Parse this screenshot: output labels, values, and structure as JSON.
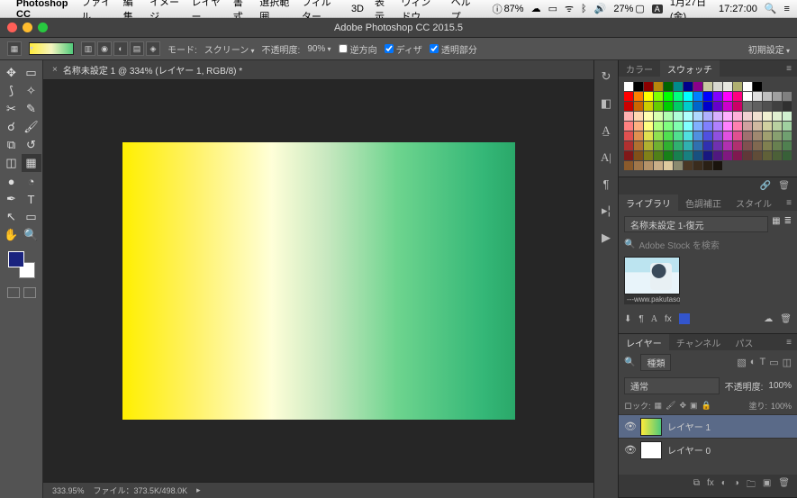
{
  "menubar": {
    "app": "Photoshop CC",
    "items": [
      "ファイル",
      "編集",
      "イメージ",
      "レイヤー",
      "書式",
      "選択範囲",
      "フィルター",
      "3D",
      "表示",
      "ウィンドウ",
      "ヘルプ"
    ],
    "cpu_pct": "87%",
    "battery": "27%",
    "lang": "A",
    "date": "1月27日(金)",
    "time": "17:27:00"
  },
  "window": {
    "title": "Adobe Photoshop CC 2015.5"
  },
  "optionsbar": {
    "mode_label": "モード:",
    "mode_value": "スクリーン",
    "opacity_label": "不透明度:",
    "opacity_value": "90%",
    "reverse": "逆方向",
    "dither": "ディザ",
    "transparency": "透明部分",
    "reset": "初期設定"
  },
  "document": {
    "tab": "名称未設定 1 @ 334% (レイヤー 1, RGB/8) *",
    "zoom": "333.95%",
    "filesize": "ファイル：373.5K/498.0K"
  },
  "panels": {
    "color_tab": "カラー",
    "swatch_tab": "スウォッチ",
    "library_tab": "ライブラリ",
    "cc_tab": "色調補正",
    "style_tab": "スタイル",
    "library_select": "名称未設定 1-復元",
    "search_placeholder": "Adobe Stock を検索",
    "thumb_caption": "---www.pakutaso....",
    "layers_tab": "レイヤー",
    "channels_tab": "チャンネル",
    "paths_tab": "パス",
    "kind_label": "種類",
    "blend_mode": "通常",
    "layer_opacity_label": "不透明度:",
    "layer_opacity_value": "100%",
    "lock_label": "ロック:",
    "fill_label": "塗り:",
    "fill_value": "100%",
    "layers": [
      {
        "name": "レイヤー 1",
        "visible": true,
        "selected": true,
        "thumb": "grad"
      },
      {
        "name": "レイヤー 0",
        "visible": true,
        "selected": false,
        "thumb": "white"
      }
    ]
  },
  "swatches": {
    "row0": [
      "#ffffff",
      "#000000",
      "#8b0000",
      "#b8860b",
      "#006400",
      "#008b8b",
      "#00008b",
      "#8b008b",
      "#c8c8a0",
      "#d8d8d0",
      "#e8e8e0",
      "#b0b070",
      "#ffffff",
      "#000000"
    ],
    "rows": [
      [
        "#ff0000",
        "#ff8000",
        "#ffff00",
        "#80ff00",
        "#00ff00",
        "#00ff80",
        "#00ffff",
        "#0080ff",
        "#0000ff",
        "#8000ff",
        "#ff00ff",
        "#ff0080",
        "#ffffff",
        "#e0e0e0",
        "#c0c0c0",
        "#a0a0a0",
        "#808080"
      ],
      [
        "#cc0000",
        "#cc6600",
        "#cccc00",
        "#66cc00",
        "#00cc00",
        "#00cc66",
        "#00cccc",
        "#0066cc",
        "#0000cc",
        "#6600cc",
        "#cc00cc",
        "#cc0066",
        "#707070",
        "#606060",
        "#505050",
        "#404040",
        "#303030"
      ],
      [
        "#ffb0b0",
        "#ffd8b0",
        "#ffffb0",
        "#d8ffb0",
        "#b0ffb0",
        "#b0ffd8",
        "#b0ffff",
        "#b0d8ff",
        "#b0b0ff",
        "#d8b0ff",
        "#ffb0ff",
        "#ffb0d8",
        "#f0d0d0",
        "#f0e0d0",
        "#f0f0d0",
        "#e0f0d0",
        "#d0f0d0"
      ],
      [
        "#ff8080",
        "#ffb080",
        "#ffff80",
        "#b0ff80",
        "#80ff80",
        "#80ffb0",
        "#80ffff",
        "#80b0ff",
        "#8080ff",
        "#b080ff",
        "#ff80ff",
        "#ff80b0",
        "#d0a0a0",
        "#d0b8a0",
        "#d0d0a0",
        "#b8d0a0",
        "#a0d0a0"
      ],
      [
        "#e05050",
        "#e09050",
        "#e0e050",
        "#90e050",
        "#50e050",
        "#50e090",
        "#50e0e0",
        "#5090e0",
        "#5050e0",
        "#9050e0",
        "#e050e0",
        "#e05090",
        "#a07070",
        "#a08870",
        "#a0a070",
        "#88a070",
        "#70a070"
      ],
      [
        "#b03030",
        "#b07030",
        "#b0b030",
        "#70b030",
        "#30b030",
        "#30b070",
        "#30b0b0",
        "#3070b0",
        "#3030b0",
        "#7030b0",
        "#b030b0",
        "#b03070",
        "#805050",
        "#806850",
        "#808050",
        "#688050",
        "#508050"
      ],
      [
        "#801818",
        "#805018",
        "#808018",
        "#508018",
        "#188018",
        "#188050",
        "#188080",
        "#185080",
        "#181880",
        "#501880",
        "#801880",
        "#801850",
        "#603838",
        "#604c38",
        "#606038",
        "#4c6038",
        "#386038"
      ],
      [
        "#8b5a2b",
        "#a0764a",
        "#b59269",
        "#c9ae88",
        "#deca9f",
        "#8a8a70",
        "#4a3825",
        "#3a2c1d",
        "#2a2015",
        "#1a140d"
      ]
    ]
  }
}
